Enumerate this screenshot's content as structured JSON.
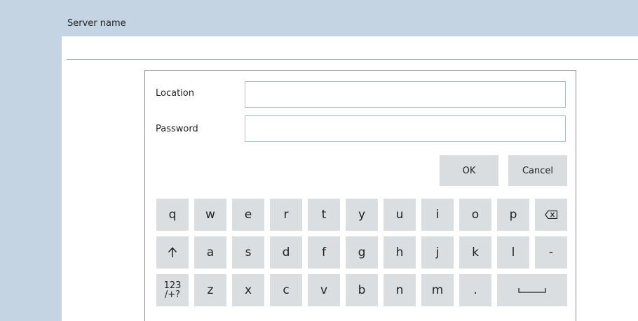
{
  "header": {
    "title": "Server name"
  },
  "form": {
    "location_label": "Location",
    "location_value": "",
    "password_label": "Password",
    "password_value": ""
  },
  "buttons": {
    "ok": "OK",
    "cancel": "Cancel"
  },
  "keyboard": {
    "row1": [
      "q",
      "w",
      "e",
      "r",
      "t",
      "y",
      "u",
      "i",
      "o",
      "p"
    ],
    "row2": [
      "a",
      "s",
      "d",
      "f",
      "g",
      "h",
      "j",
      "k",
      "l",
      "-"
    ],
    "row3": [
      "z",
      "x",
      "c",
      "v",
      "b",
      "n",
      "m",
      "."
    ],
    "numeric_toggle": "123\n/+?",
    "icons": {
      "backspace": "backspace-icon",
      "shift": "shift-arrow-icon",
      "space": "space-bar-icon"
    }
  },
  "colors": {
    "background": "#c5d4e3",
    "key": "#dadee1",
    "border": "#a9bccd"
  }
}
